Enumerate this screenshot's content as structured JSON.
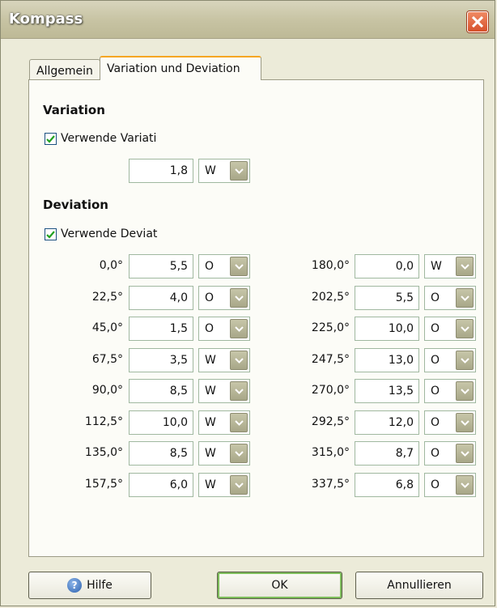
{
  "window": {
    "title": "Kompass"
  },
  "tabs": [
    {
      "label": "Allgemein"
    },
    {
      "label": "Variation und Deviation"
    }
  ],
  "variation": {
    "heading": "Variation",
    "checkbox_label": "Verwende Variati",
    "checked": true,
    "value": "1,8",
    "direction": "W"
  },
  "deviation": {
    "heading": "Deviation",
    "checkbox_label": "Verwende Deviat",
    "checked": true,
    "left_rows": [
      {
        "angle": "0,0°",
        "value": "5,5",
        "dir": "O"
      },
      {
        "angle": "22,5°",
        "value": "4,0",
        "dir": "O"
      },
      {
        "angle": "45,0°",
        "value": "1,5",
        "dir": "O"
      },
      {
        "angle": "67,5°",
        "value": "3,5",
        "dir": "W"
      },
      {
        "angle": "90,0°",
        "value": "8,5",
        "dir": "W"
      },
      {
        "angle": "112,5°",
        "value": "10,0",
        "dir": "W"
      },
      {
        "angle": "135,0°",
        "value": "8,5",
        "dir": "W"
      },
      {
        "angle": "157,5°",
        "value": "6,0",
        "dir": "W"
      }
    ],
    "right_rows": [
      {
        "angle": "180,0°",
        "value": "0,0",
        "dir": "W"
      },
      {
        "angle": "202,5°",
        "value": "5,5",
        "dir": "O"
      },
      {
        "angle": "225,0°",
        "value": "10,0",
        "dir": "O"
      },
      {
        "angle": "247,5°",
        "value": "13,0",
        "dir": "O"
      },
      {
        "angle": "270,0°",
        "value": "13,5",
        "dir": "O"
      },
      {
        "angle": "292,5°",
        "value": "12,0",
        "dir": "O"
      },
      {
        "angle": "315,0°",
        "value": "8,7",
        "dir": "O"
      },
      {
        "angle": "337,5°",
        "value": "6,8",
        "dir": "O"
      }
    ]
  },
  "buttons": {
    "help": "Hilfe",
    "ok": "OK",
    "cancel": "Annullieren"
  },
  "icons": {
    "close": "close-icon",
    "help": "help-icon",
    "check": "checkmark-icon",
    "dropdown": "chevron-down-icon"
  }
}
